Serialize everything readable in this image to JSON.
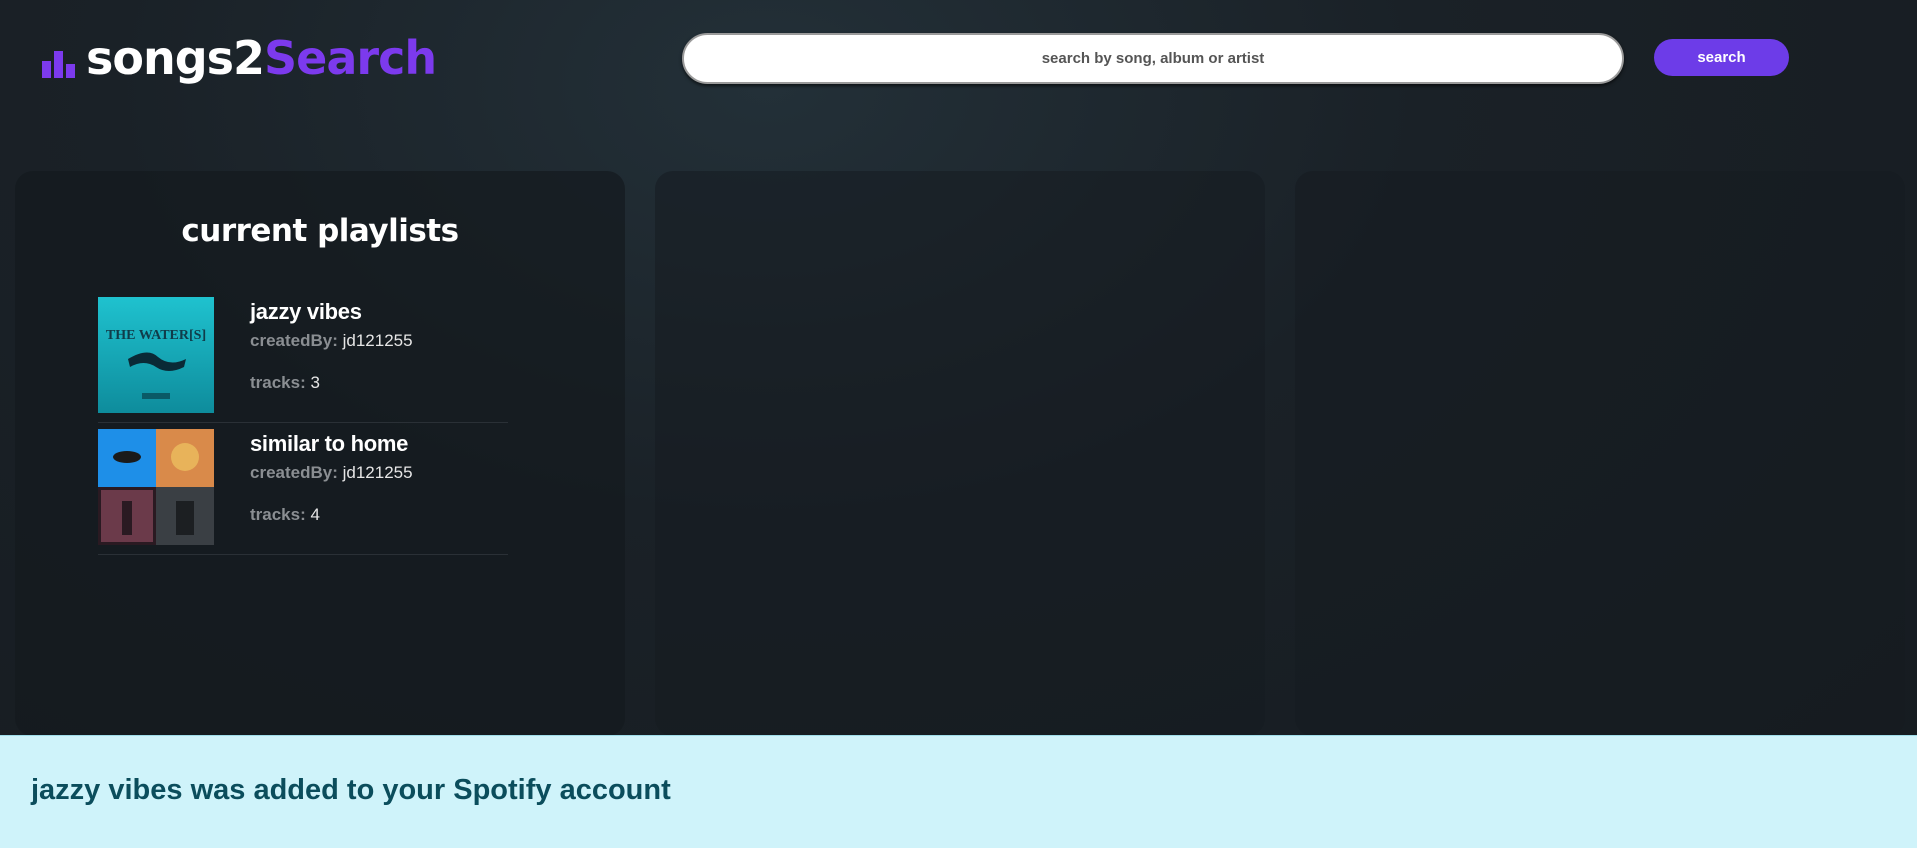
{
  "header": {
    "logo_text_white": "songs2",
    "logo_text_purple": "Search",
    "logo_icon": "bar-chart-icon",
    "search_placeholder": "search by song, album or artist",
    "search_button_label": "search"
  },
  "colors": {
    "accent": "#7c3aed",
    "button": "#6d3ce8",
    "notification_bg": "#cff3fa",
    "notification_text": "#0b4d5c"
  },
  "playlists_panel": {
    "title": "current playlists",
    "created_by_label": "createdBy:",
    "tracks_label": "tracks:",
    "items": [
      {
        "name": "jazzy vibes",
        "created_by": "jd121255",
        "tracks": "3",
        "cover_text": "THE WATER[S]"
      },
      {
        "name": "similar to home",
        "created_by": "jd121255",
        "tracks": "4"
      }
    ]
  },
  "notification": {
    "message": "jazzy vibes was added to your Spotify account"
  }
}
